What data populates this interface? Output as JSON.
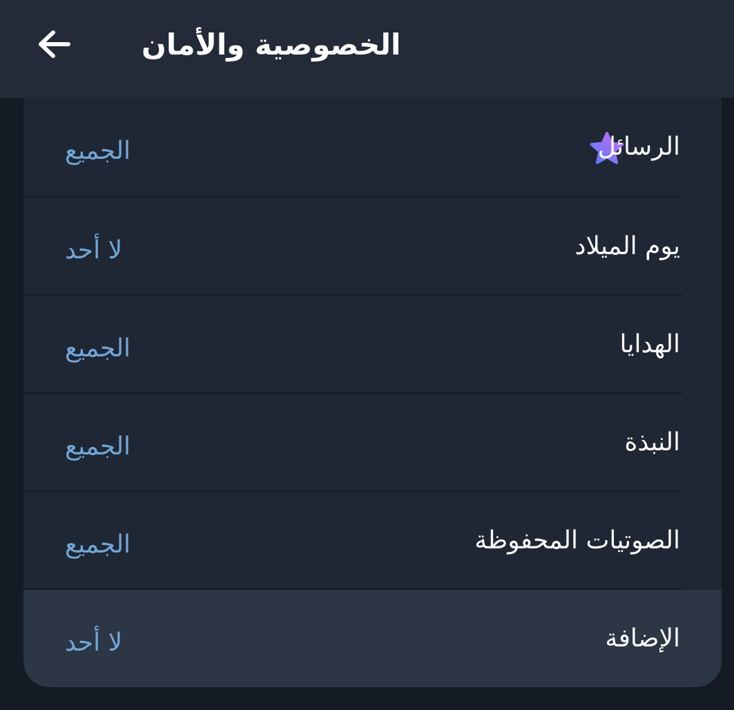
{
  "header": {
    "title": "الخصوصية والأمان",
    "back_icon": "arrow-left-icon"
  },
  "settings": {
    "items": [
      {
        "label": "الرسائل",
        "value": "الجميع",
        "icon": "premium-star-icon"
      },
      {
        "label": "يوم الميلاد",
        "value": "لا أحد"
      },
      {
        "label": "الهدايا",
        "value": "الجميع"
      },
      {
        "label": "النبذة",
        "value": "الجميع"
      },
      {
        "label": "الصوتيات المحفوظة",
        "value": "الجميع"
      },
      {
        "label": "الإضافة",
        "value": "لا أحد"
      }
    ]
  },
  "colors": {
    "background": "#151b24",
    "header": "#232b39",
    "card": "#1f2734",
    "highlight": "#2c3645",
    "value_text": "#72a7d8",
    "star_gradient_start": "#5b7cff",
    "star_gradient_end": "#c66bf0"
  }
}
